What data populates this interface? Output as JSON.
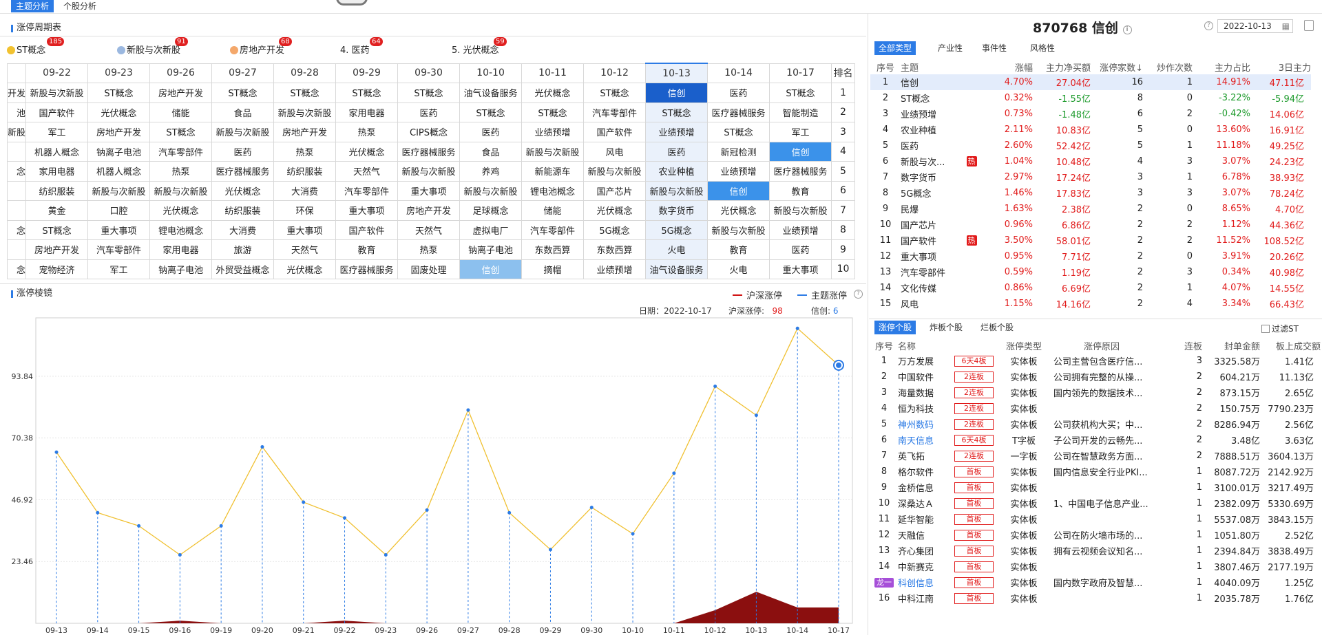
{
  "top_tabs": {
    "active": "主题分析",
    "other": "个股分析"
  },
  "cycle_section": {
    "title": "涨停周期表",
    "themes": [
      {
        "label": "ST概念",
        "count": "185",
        "color": "#f2c230"
      },
      {
        "label": "新股与次新股",
        "count": "91",
        "color": "#9bb8e0"
      },
      {
        "label": "房地产开发",
        "count": "68",
        "color": "#f4a86b"
      },
      {
        "label": "4. 医药",
        "count": "64",
        "color": ""
      },
      {
        "label": "5. 光伏概念",
        "count": "59",
        "color": ""
      }
    ],
    "dates": [
      "09-22",
      "09-23",
      "09-26",
      "09-27",
      "09-28",
      "09-29",
      "09-30",
      "10-10",
      "10-11",
      "10-12",
      "10-13",
      "10-14",
      "10-17"
    ],
    "rank_header": "排名",
    "left_cut": [
      "开发",
      "池",
      "新股",
      "",
      "念",
      "",
      "",
      "念",
      "",
      "念"
    ],
    "rows": [
      [
        "新股与次新股",
        "ST概念",
        "房地产开发",
        "ST概念",
        "ST概念",
        "ST概念",
        "ST概念",
        "油气设备服务",
        "光伏概念",
        "ST概念",
        "信创",
        "医药",
        "ST概念"
      ],
      [
        "国产软件",
        "光伏概念",
        "储能",
        "食品",
        "新股与次新股",
        "家用电器",
        "医药",
        "ST概念",
        "ST概念",
        "汽车零部件",
        "ST概念",
        "医疗器械服务",
        "智能制造"
      ],
      [
        "军工",
        "房地产开发",
        "ST概念",
        "新股与次新股",
        "房地产开发",
        "热泵",
        "CIPS概念",
        "医药",
        "业绩预增",
        "国产软件",
        "业绩预增",
        "ST概念",
        "军工"
      ],
      [
        "机器人概念",
        "钠离子电池",
        "汽车零部件",
        "医药",
        "热泵",
        "光伏概念",
        "医疗器械服务",
        "食品",
        "新股与次新股",
        "风电",
        "医药",
        "新冠检测",
        "信创"
      ],
      [
        "家用电器",
        "机器人概念",
        "热泵",
        "医疗器械服务",
        "纺织服装",
        "天然气",
        "新股与次新股",
        "养鸡",
        "新能源车",
        "新股与次新股",
        "农业种植",
        "业绩预增",
        "医疗器械服务"
      ],
      [
        "纺织服装",
        "新股与次新股",
        "新股与次新股",
        "光伏概念",
        "大消费",
        "汽车零部件",
        "重大事项",
        "新股与次新股",
        "锂电池概念",
        "国产芯片",
        "新股与次新股",
        "信创",
        "教育"
      ],
      [
        "黄金",
        "口腔",
        "光伏概念",
        "纺织服装",
        "环保",
        "重大事项",
        "房地产开发",
        "足球概念",
        "储能",
        "光伏概念",
        "数字货币",
        "光伏概念",
        "新股与次新股"
      ],
      [
        "ST概念",
        "重大事项",
        "锂电池概念",
        "大消费",
        "重大事项",
        "国产软件",
        "天然气",
        "虚拟电厂",
        "汽车零部件",
        "5G概念",
        "5G概念",
        "新股与次新股",
        "业绩预增"
      ],
      [
        "房地产开发",
        "汽车零部件",
        "家用电器",
        "旅游",
        "天然气",
        "教育",
        "热泵",
        "钠离子电池",
        "东数西算",
        "东数西算",
        "火电",
        "教育",
        "医药"
      ],
      [
        "宠物经济",
        "军工",
        "钠离子电池",
        "外贸受益概念",
        "光伏概念",
        "医疗器械服务",
        "固废处理",
        "信创",
        "摘帽",
        "业绩预增",
        "油气设备服务",
        "火电",
        "重大事项"
      ]
    ]
  },
  "mirror_section": {
    "title": "涨停棱镜",
    "legend_a": "沪深涨停",
    "legend_b": "主题涨停",
    "color_a": "#d01010",
    "color_b": "#2c7be5",
    "date_label": "日期：",
    "date_value": "2022-10-17",
    "hs_label": "沪深涨停:",
    "hs_value": "98",
    "xc_label": "信创:",
    "xc_value": "6"
  },
  "chart_data": {
    "type": "line",
    "x": [
      "09-13",
      "09-14",
      "09-15",
      "09-16",
      "09-19",
      "09-20",
      "09-21",
      "09-22",
      "09-23",
      "09-26",
      "09-27",
      "09-28",
      "09-29",
      "09-30",
      "10-10",
      "10-11",
      "10-12",
      "10-13",
      "10-14",
      "10-17"
    ],
    "yticks": [
      "23.46",
      "46.92",
      "70.38",
      "93.84"
    ],
    "ylim": [
      0,
      116
    ],
    "series": [
      {
        "name": "沪深涨停",
        "type": "line",
        "color": "#f0c030",
        "values": [
          65,
          42,
          37,
          26,
          37,
          67,
          46,
          40,
          26,
          43,
          81,
          42,
          28,
          44,
          34,
          57,
          90,
          79,
          112,
          98
        ]
      },
      {
        "name": "主题涨停",
        "type": "area",
        "color": "#8b0f0f",
        "values": [
          0,
          0,
          0,
          1,
          0,
          0,
          0,
          1,
          0,
          0,
          0,
          0,
          0,
          0,
          0,
          0,
          5,
          12,
          6,
          6
        ]
      }
    ]
  },
  "stock": {
    "code_name": "870768 信创",
    "date": "2022-10-13"
  },
  "right_tabs": [
    "全部类型",
    "产业性",
    "事件性",
    "风格性"
  ],
  "theme_table": {
    "headers": [
      "序号",
      "主题",
      "涨幅",
      "主力净买额",
      "涨停家数↓",
      "炒作次数",
      "主力占比",
      "3日主力"
    ],
    "rows": [
      {
        "no": "1",
        "name": "信创",
        "hot": "",
        "chg": "4.70%",
        "net": "27.04亿",
        "limit": "16",
        "times": "1",
        "ratio": "14.91%",
        "d3": "47.11亿"
      },
      {
        "no": "2",
        "name": "ST概念",
        "hot": "",
        "chg": "0.32%",
        "net": "-1.55亿",
        "limit": "8",
        "times": "0",
        "ratio": "-3.22%",
        "d3": "-5.94亿"
      },
      {
        "no": "3",
        "name": "业绩预增",
        "hot": "",
        "chg": "0.73%",
        "net": "-1.48亿",
        "limit": "6",
        "times": "2",
        "ratio": "-0.42%",
        "d3": "14.06亿"
      },
      {
        "no": "4",
        "name": "农业种植",
        "hot": "",
        "chg": "2.11%",
        "net": "10.83亿",
        "limit": "5",
        "times": "0",
        "ratio": "13.60%",
        "d3": "16.91亿"
      },
      {
        "no": "5",
        "name": "医药",
        "hot": "",
        "chg": "2.60%",
        "net": "52.42亿",
        "limit": "5",
        "times": "1",
        "ratio": "11.18%",
        "d3": "49.25亿"
      },
      {
        "no": "6",
        "name": "新股与次...",
        "hot": "热",
        "chg": "1.04%",
        "net": "10.48亿",
        "limit": "4",
        "times": "3",
        "ratio": "3.07%",
        "d3": "24.23亿"
      },
      {
        "no": "7",
        "name": "数字货币",
        "hot": "",
        "chg": "2.97%",
        "net": "17.24亿",
        "limit": "3",
        "times": "1",
        "ratio": "6.78%",
        "d3": "38.93亿"
      },
      {
        "no": "8",
        "name": "5G概念",
        "hot": "",
        "chg": "1.46%",
        "net": "17.83亿",
        "limit": "3",
        "times": "3",
        "ratio": "3.07%",
        "d3": "78.24亿"
      },
      {
        "no": "9",
        "name": "民爆",
        "hot": "",
        "chg": "1.63%",
        "net": "2.38亿",
        "limit": "2",
        "times": "0",
        "ratio": "8.65%",
        "d3": "4.70亿"
      },
      {
        "no": "10",
        "name": "国产芯片",
        "hot": "",
        "chg": "0.96%",
        "net": "6.86亿",
        "limit": "2",
        "times": "2",
        "ratio": "1.12%",
        "d3": "44.36亿"
      },
      {
        "no": "11",
        "name": "国产软件",
        "hot": "热",
        "chg": "3.50%",
        "net": "58.01亿",
        "limit": "2",
        "times": "2",
        "ratio": "11.52%",
        "d3": "108.52亿"
      },
      {
        "no": "12",
        "name": "重大事项",
        "hot": "",
        "chg": "0.95%",
        "net": "7.71亿",
        "limit": "2",
        "times": "0",
        "ratio": "3.91%",
        "d3": "20.26亿"
      },
      {
        "no": "13",
        "name": "汽车零部件",
        "hot": "",
        "chg": "0.59%",
        "net": "1.19亿",
        "limit": "2",
        "times": "3",
        "ratio": "0.34%",
        "d3": "40.98亿"
      },
      {
        "no": "14",
        "name": "文化传媒",
        "hot": "",
        "chg": "0.86%",
        "net": "6.69亿",
        "limit": "2",
        "times": "1",
        "ratio": "4.07%",
        "d3": "14.55亿"
      },
      {
        "no": "15",
        "name": "风电",
        "hot": "",
        "chg": "1.15%",
        "net": "14.16亿",
        "limit": "2",
        "times": "4",
        "ratio": "3.34%",
        "d3": "66.43亿"
      }
    ]
  },
  "stock_tabs": [
    "涨停个股",
    "炸板个股",
    "烂板个股"
  ],
  "filter_st": "过滤ST",
  "stock_table": {
    "headers": [
      "序号",
      "名称",
      "涨停类型",
      "涨停原因",
      "连板",
      "封单金额",
      "板上成交额"
    ],
    "rows": [
      {
        "no": "1",
        "name": "万方发展",
        "board": "6天4板",
        "type": "实体板",
        "reason": "公司主营包含医疗信...",
        "lian": "3",
        "seal": "3325.58万",
        "amt": "1.41亿",
        "blue": false
      },
      {
        "no": "2",
        "name": "中国软件",
        "board": "2连板",
        "type": "实体板",
        "reason": "公司拥有完整的从操...",
        "lian": "2",
        "seal": "604.21万",
        "amt": "11.13亿",
        "blue": false
      },
      {
        "no": "3",
        "name": "海量数据",
        "board": "2连板",
        "type": "实体板",
        "reason": "国内领先的数据技术...",
        "lian": "2",
        "seal": "873.15万",
        "amt": "2.65亿",
        "blue": false
      },
      {
        "no": "4",
        "name": "恒为科技",
        "board": "2连板",
        "type": "实体板",
        "reason": "",
        "lian": "2",
        "seal": "150.75万",
        "amt": "7790.23万",
        "blue": false
      },
      {
        "no": "5",
        "name": "神州数码",
        "board": "2连板",
        "type": "实体板",
        "reason": "公司获机构大买；中...",
        "lian": "2",
        "seal": "8286.94万",
        "amt": "2.56亿",
        "blue": true
      },
      {
        "no": "6",
        "name": "南天信息",
        "board": "6天4板",
        "type": "T字板",
        "reason": "子公司开发的云畅先...",
        "lian": "2",
        "seal": "3.48亿",
        "amt": "3.63亿",
        "blue": true
      },
      {
        "no": "7",
        "name": "英飞拓",
        "board": "2连板",
        "type": "一字板",
        "reason": "公司在智慧政务方面...",
        "lian": "2",
        "seal": "7888.51万",
        "amt": "3604.13万",
        "blue": false
      },
      {
        "no": "8",
        "name": "格尔软件",
        "board": "首板",
        "type": "实体板",
        "reason": "国内信息安全行业PKI...",
        "lian": "1",
        "seal": "8087.72万",
        "amt": "2142.92万",
        "blue": false
      },
      {
        "no": "9",
        "name": "金桥信息",
        "board": "首板",
        "type": "实体板",
        "reason": "",
        "lian": "1",
        "seal": "3100.01万",
        "amt": "3217.49万",
        "blue": false
      },
      {
        "no": "10",
        "name": "深桑达Ａ",
        "board": "首板",
        "type": "实体板",
        "reason": "1、中国电子信息产业...",
        "lian": "1",
        "seal": "2382.09万",
        "amt": "5330.69万",
        "blue": false
      },
      {
        "no": "11",
        "name": "延华智能",
        "board": "首板",
        "type": "实体板",
        "reason": "",
        "lian": "1",
        "seal": "5537.08万",
        "amt": "3843.15万",
        "blue": false
      },
      {
        "no": "12",
        "name": "天融信",
        "board": "首板",
        "type": "实体板",
        "reason": "公司在防火墙市场的...",
        "lian": "1",
        "seal": "1051.80万",
        "amt": "2.52亿",
        "blue": false
      },
      {
        "no": "13",
        "name": "齐心集团",
        "board": "首板",
        "type": "实体板",
        "reason": "拥有云视频会议知名...",
        "lian": "1",
        "seal": "2394.84万",
        "amt": "3838.49万",
        "blue": false
      },
      {
        "no": "14",
        "name": "中新赛克",
        "board": "首板",
        "type": "实体板",
        "reason": "",
        "lian": "1",
        "seal": "3807.46万",
        "amt": "2177.19万",
        "blue": false
      },
      {
        "no": "龙一",
        "name": "科创信息",
        "board": "首板",
        "type": "实体板",
        "reason": "国内数字政府及智慧...",
        "lian": "1",
        "seal": "4040.09万",
        "amt": "1.25亿",
        "blue": true
      },
      {
        "no": "16",
        "name": "中科江南",
        "board": "首板",
        "type": "实体板",
        "reason": "",
        "lian": "1",
        "seal": "2035.78万",
        "amt": "1.76亿",
        "blue": false
      }
    ]
  }
}
